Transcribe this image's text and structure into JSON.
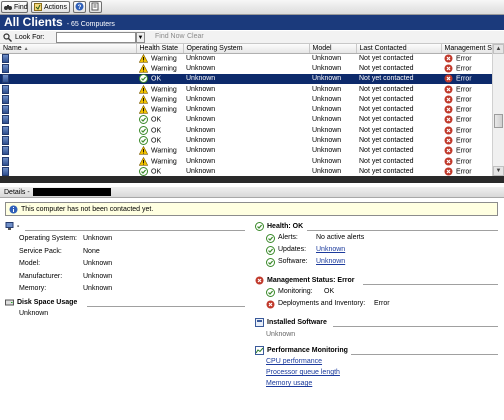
{
  "toolbar": {
    "find_label": "Find",
    "actions_label": "Actions",
    "help_icon": "help-icon",
    "properties_icon": "properties-icon"
  },
  "header": {
    "title": "All Clients",
    "subtitle": "- 65 Computers"
  },
  "search": {
    "look_for_label": "Look For:",
    "value": "",
    "find_now_label": "Find Now",
    "clear_label": "Clear"
  },
  "grid": {
    "columns": [
      "Name",
      "Health State",
      "Operating System",
      "Model",
      "Last Contacted",
      "Management S"
    ],
    "rows": [
      {
        "health": "Warning",
        "health_icon": "warning",
        "os": "Unknown",
        "model": "Unknown",
        "contacted": "Not yet contacted",
        "mgmt": "Error"
      },
      {
        "health": "Warning",
        "health_icon": "warning",
        "os": "Unknown",
        "model": "Unknown",
        "contacted": "Not yet contacted",
        "mgmt": "Error"
      },
      {
        "health": "OK",
        "health_icon": "ok",
        "os": "Unknown",
        "model": "Unknown",
        "contacted": "Not yet contacted",
        "mgmt": "Error",
        "selected": true
      },
      {
        "health": "Warning",
        "health_icon": "warning",
        "os": "Unknown",
        "model": "Unknown",
        "contacted": "Not yet contacted",
        "mgmt": "Error"
      },
      {
        "health": "Warning",
        "health_icon": "warning",
        "os": "Unknown",
        "model": "Unknown",
        "contacted": "Not yet contacted",
        "mgmt": "Error"
      },
      {
        "health": "Warning",
        "health_icon": "warning",
        "os": "Unknown",
        "model": "Unknown",
        "contacted": "Not yet contacted",
        "mgmt": "Error"
      },
      {
        "health": "OK",
        "health_icon": "ok",
        "os": "Unknown",
        "model": "Unknown",
        "contacted": "Not yet contacted",
        "mgmt": "Error"
      },
      {
        "health": "OK",
        "health_icon": "ok",
        "os": "Unknown",
        "model": "Unknown",
        "contacted": "Not yet contacted",
        "mgmt": "Error"
      },
      {
        "health": "OK",
        "health_icon": "ok",
        "os": "Unknown",
        "model": "Unknown",
        "contacted": "Not yet contacted",
        "mgmt": "Error"
      },
      {
        "health": "Warning",
        "health_icon": "warning",
        "os": "Unknown",
        "model": "Unknown",
        "contacted": "Not yet contacted",
        "mgmt": "Error"
      },
      {
        "health": "Warning",
        "health_icon": "warning",
        "os": "Unknown",
        "model": "Unknown",
        "contacted": "Not yet contacted",
        "mgmt": "Error"
      },
      {
        "health": "OK",
        "health_icon": "ok",
        "os": "Unknown",
        "model": "Unknown",
        "contacted": "Not yet contacted",
        "mgmt": "Error"
      }
    ]
  },
  "details": {
    "header_label": "Details -",
    "banner": "This computer has not been contacted yet.",
    "name_heading": "-",
    "system": [
      {
        "k": "Operating System:",
        "v": "Unknown"
      },
      {
        "k": "Service Pack:",
        "v": "None"
      },
      {
        "k": "Model:",
        "v": "Unknown"
      },
      {
        "k": "Manufacturer:",
        "v": "Unknown"
      },
      {
        "k": "Memory:",
        "v": "Unknown"
      }
    ],
    "disk": {
      "title": "Disk Space Usage",
      "value": "Unknown"
    },
    "health": {
      "title": "Health: OK",
      "items": [
        {
          "k": "Alerts:",
          "v": "No active alerts",
          "link": false
        },
        {
          "k": "Updates:",
          "v": "Unknown",
          "link": true
        },
        {
          "k": "Software:",
          "v": "Unknown",
          "link": true
        }
      ]
    },
    "management": {
      "title": "Management Status: Error",
      "items": [
        {
          "k": "Monitoring:",
          "v": "OK",
          "icon": "ok"
        },
        {
          "k": "Deployments and Inventory:",
          "v": "Error",
          "icon": "error"
        }
      ]
    },
    "software": {
      "title": "Installed Software",
      "value": "Unknown"
    },
    "performance": {
      "title": "Performance Monitoring",
      "links": [
        "CPU performance",
        "Processor queue length",
        "Memory usage"
      ]
    }
  },
  "colors": {
    "title_bg": "#1b3a7c",
    "selected_row": "#0d2a6b",
    "banner_bg": "#ffffe1",
    "link": "#1b3a9c",
    "error_red": "#c0392b",
    "ok_green": "#3a8a2a",
    "warning_yellow": "#f2c200"
  }
}
